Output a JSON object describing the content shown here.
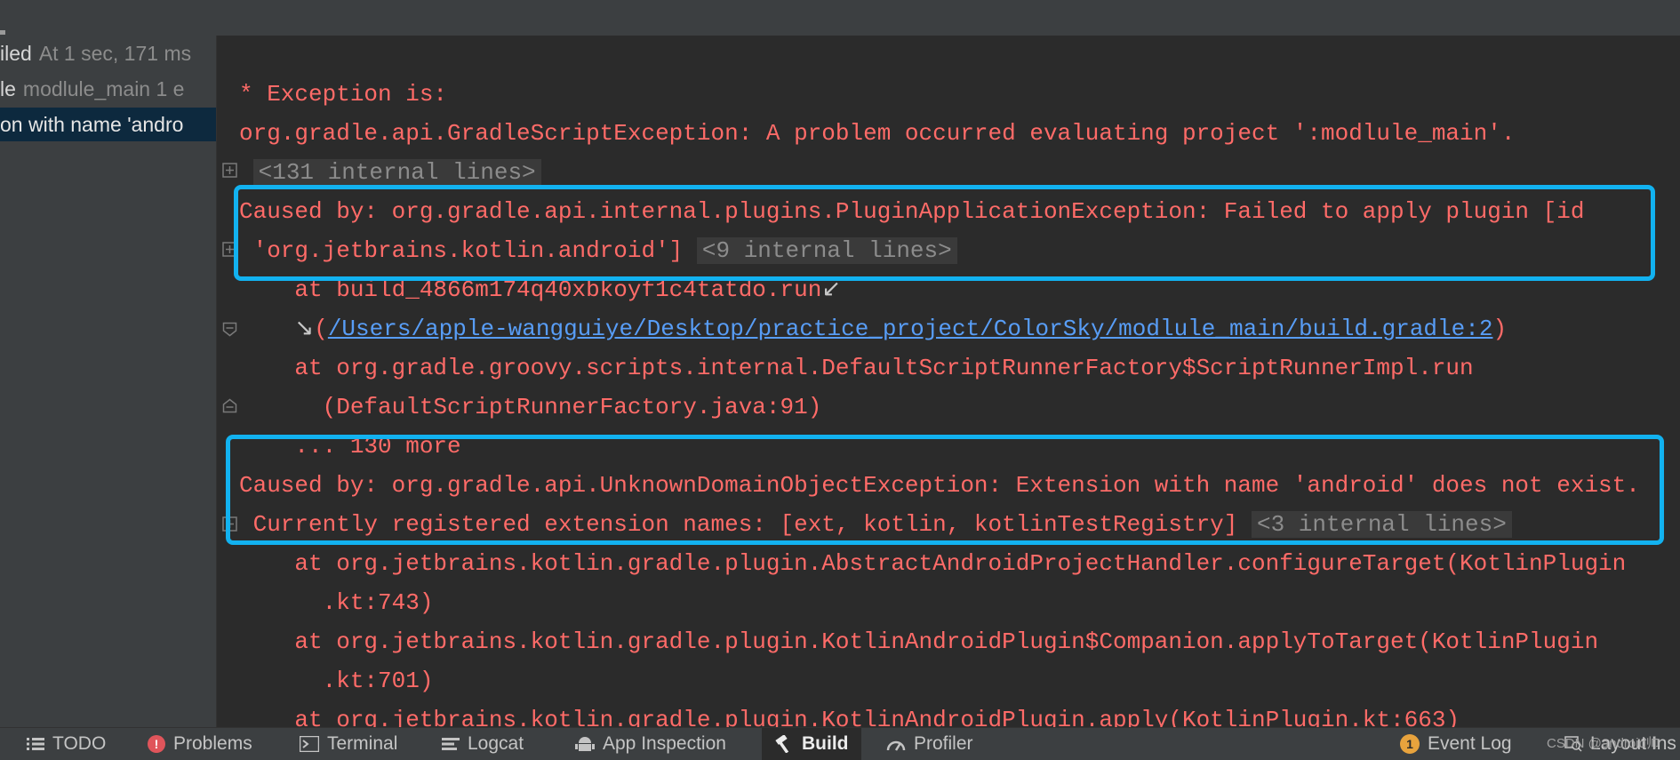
{
  "colors": {
    "error_text": "#ff6b68",
    "link": "#589df6",
    "highlight_border": "#12b2f0",
    "panel_bg": "#3c3f41",
    "console_bg": "#2b2b2b"
  },
  "left_panel": {
    "rows": [
      {
        "title": "iled",
        "detail": "At 1 sec, 171 ms"
      },
      {
        "title": "le",
        "detail": "modlule_main 1 e"
      },
      {
        "title": "on with name 'andro",
        "detail": ""
      }
    ]
  },
  "console": {
    "l1": "* Exception is:",
    "l2": "org.gradle.api.GradleScriptException: A problem occurred evaluating project ':modlule_main'.",
    "l3_fold": "<131 internal lines>",
    "l4": "Caused by: org.gradle.api.internal.plugins.PluginApplicationException: Failed to apply plugin [id",
    "l5_text": " 'org.jetbrains.kotlin.android']",
    "l5_fold": "<9 internal lines>",
    "l6": "    at build_4866m174q40xbkoyf1c4tatdo.run",
    "l6_arrow": "↙",
    "l7_arrow": "↘",
    "l7_open": "(",
    "l7_link": "/Users/apple-wangguiye/Desktop/practice_project/ColorSky/modlule_main/build.gradle:2",
    "l7_close": ")",
    "l8": "    at org.gradle.groovy.scripts.internal.DefaultScriptRunnerFactory$ScriptRunnerImpl.run",
    "l9": "      (DefaultScriptRunnerFactory.java:91)",
    "l10": "    ... 130 more",
    "l11": "Caused by: org.gradle.api.UnknownDomainObjectException: Extension with name 'android' does not exist.",
    "l12_text": " Currently registered extension names: [ext, kotlin, kotlinTestRegistry]",
    "l12_fold": "<3 internal lines>",
    "l13": "    at org.jetbrains.kotlin.gradle.plugin.AbstractAndroidProjectHandler.configureTarget(KotlinPlugin",
    "l14": "      .kt:743)",
    "l15": "    at org.jetbrains.kotlin.gradle.plugin.KotlinAndroidPlugin$Companion.applyToTarget(KotlinPlugin",
    "l16": "      .kt:701)",
    "l17": "    at org.jetbrains.kotlin.gradle.plugin.KotlinAndroidPlugin.apply(KotlinPlugin.kt:663)"
  },
  "toolbar": {
    "todo": "TODO",
    "problems": "Problems",
    "terminal": "Terminal",
    "logcat": "Logcat",
    "app_inspection": "App Inspection",
    "build": "Build",
    "profiler": "Profiler",
    "event_log": "Event Log",
    "event_log_count": "1",
    "layout_inspector": "Layout Ins"
  },
  "watermark": "CSDN @android帅"
}
